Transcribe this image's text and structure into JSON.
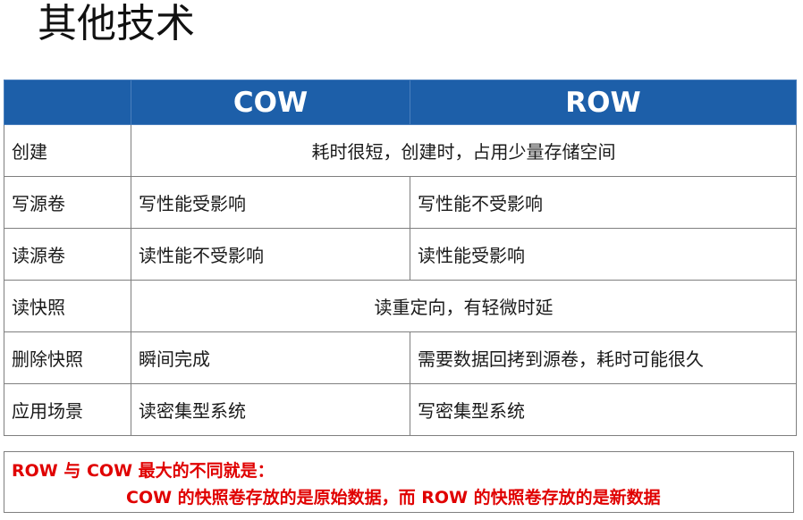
{
  "title": "其他技术",
  "table": {
    "headers": [
      "",
      "COW",
      "ROW"
    ],
    "rows": [
      {
        "label": "创建",
        "merged": "耗时很短，创建时，占用少量存储空间"
      },
      {
        "label": "写源卷",
        "cow": "写性能受影响",
        "row": "写性能不受影响"
      },
      {
        "label": "读源卷",
        "cow": "读性能不受影响",
        "row": "读性能受影响"
      },
      {
        "label": "读快照",
        "merged": "读重定向，有轻微时延"
      },
      {
        "label": "删除快照",
        "cow": "瞬间完成",
        "row": "需要数据回拷到源卷，耗时可能很久"
      },
      {
        "label": "应用场景",
        "cow": "读密集型系统",
        "row": "写密集型系统"
      }
    ]
  },
  "note": {
    "line1": "ROW 与 COW 最大的不同就是：",
    "line2": "COW 的快照卷存放的是原始数据，而 ROW 的快照卷存放的是新数据"
  },
  "colors": {
    "header_bg": "#1d5fa9",
    "header_text": "#ffffff",
    "note_text": "#e00000",
    "border": "#7f7f7f"
  }
}
